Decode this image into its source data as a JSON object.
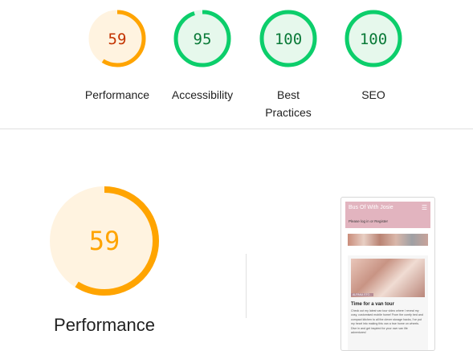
{
  "gauges": [
    {
      "label": "Performance",
      "score": "59",
      "value": 0.59,
      "color": "#ffa400",
      "fill": "#fff3e0",
      "text_color": "#c33300"
    },
    {
      "label": "Accessibility",
      "score": "95",
      "value": 0.95,
      "color": "#0cce6b",
      "fill": "#e6f8ec",
      "text_color": "#0a7a38"
    },
    {
      "label": "Best Practices",
      "score": "100",
      "value": 1.0,
      "color": "#0cce6b",
      "fill": "#e6f8ec",
      "text_color": "#0a7a38"
    },
    {
      "label": "SEO",
      "score": "100",
      "value": 1.0,
      "color": "#0cce6b",
      "fill": "#e6f8ec",
      "text_color": "#0a7a38"
    }
  ],
  "performance": {
    "score": "59",
    "value": 0.59,
    "title": "Performance",
    "color": "#ffa400",
    "fill": "#fff3e0"
  },
  "screenshot": {
    "site_title": "Bus Of With Josie",
    "menu_icon": "hamburger-menu-icon",
    "login_text": "Please log in or Register",
    "image_caption": "ALPAKA STO...",
    "card_title": "Time for a van tour",
    "card_body": "Check out my latest van tour video where I reveal my cosy, customised mobile home! From the comfy bed and compact kitchen to all the clever storage hacks, I've put my heart into making this van a true home on wheels. Dive in and get inspired for your own van life adventures!"
  }
}
